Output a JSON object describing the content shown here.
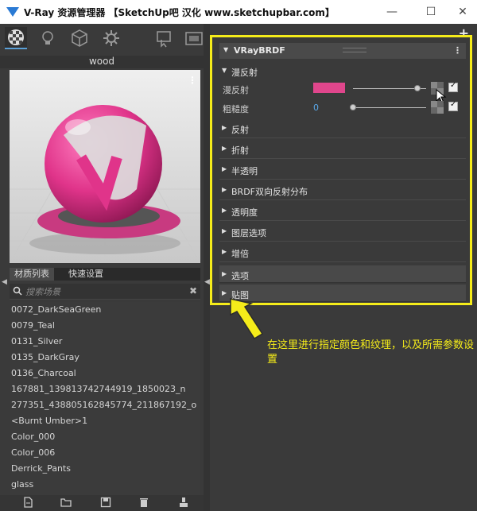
{
  "window": {
    "title": "V-Ray 资源管理器 【SketchUp吧 汉化 www.sketchupbar.com】",
    "minimize": "—",
    "maximize": "☐",
    "close": "✕"
  },
  "left_panel": {
    "material_name": "wood",
    "preview_menu": "⋮",
    "tabs": [
      {
        "label": "材质列表"
      },
      {
        "label": "快速设置"
      }
    ],
    "search": {
      "placeholder": "搜索场景",
      "clear": "✖"
    },
    "materials": [
      "0072_DarkSeaGreen",
      "0079_Teal",
      "0131_Silver",
      "0135_DarkGray",
      "0136_Charcoal",
      "167881_139813742744919_1850023_n",
      "277351_438805162845774_211867192_o",
      "<Burnt Umber>1",
      "Color_000",
      "Color_006",
      "Derrick_Pants",
      "glass"
    ],
    "collapse_arrow": "◀"
  },
  "splitter": {
    "arrow": "◀"
  },
  "right_panel": {
    "add": "+",
    "brdf_header": {
      "label": "VRayBRDF",
      "menu": "⋮"
    },
    "diffuse_section": "漫反射",
    "params": {
      "diffuse": {
        "label": "漫反射",
        "swatch_color": "#e0468c",
        "slider_value": 0.88,
        "checked": true
      },
      "roughness": {
        "label": "粗糙度",
        "value": "0",
        "slider_value": 0.0,
        "checked": true
      }
    },
    "sections": [
      "反射",
      "折射",
      "半透明",
      "BRDF双向反射分布",
      "透明度",
      "图层选项",
      "增倍"
    ],
    "dark_sections": [
      "选项",
      "贴图"
    ]
  },
  "annotation": {
    "text": "在这里进行指定颜色和纹理，以及所需参数设置",
    "color": "#f5ec1a"
  }
}
